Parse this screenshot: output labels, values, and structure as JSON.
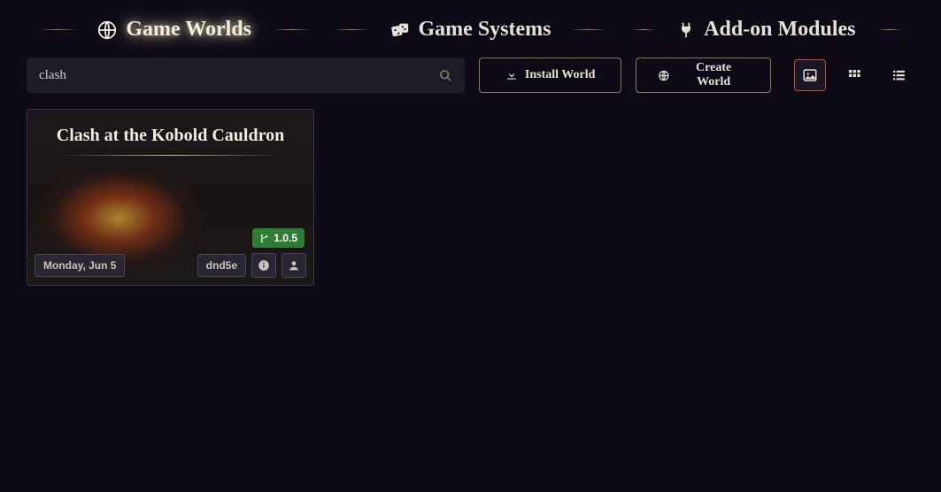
{
  "tabs": {
    "worlds": "Game Worlds",
    "systems": "Game Systems",
    "modules": "Add-on Modules"
  },
  "search": {
    "value": "clash"
  },
  "buttons": {
    "install": "Install World",
    "create": "Create World"
  },
  "card": {
    "title": "Clash at the Kobold Cauldron",
    "version": "1.0.5",
    "date": "Monday, Jun 5",
    "system": "dnd5e"
  }
}
